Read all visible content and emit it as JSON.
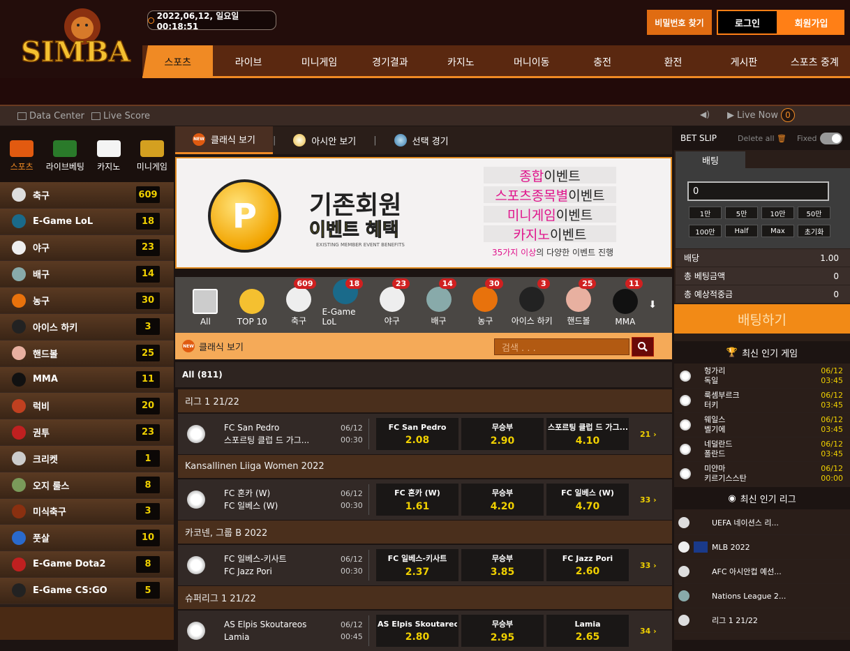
{
  "header": {
    "logo_text": "SIMBA",
    "datetime": "2022,06,12, 일요일 00:18:51",
    "find_password": "비밀번호 찾기",
    "login": "로그인",
    "join": "회원가입"
  },
  "nav": [
    "스포츠",
    "라이브",
    "미니게임",
    "경기결과",
    "카지노",
    "머니이동",
    "충전",
    "환전",
    "게시판",
    "스포츠 중계"
  ],
  "databar": {
    "data_center": "Data Center",
    "live_score": "Live Score",
    "live_now": "Live Now",
    "live_count": "0"
  },
  "left_tabs": [
    "스포츠",
    "라이브베팅",
    "카지노",
    "미니게임"
  ],
  "sports": [
    {
      "name": "축구",
      "count": "609"
    },
    {
      "name": "E-Game LoL",
      "count": "18"
    },
    {
      "name": "야구",
      "count": "23"
    },
    {
      "name": "배구",
      "count": "14"
    },
    {
      "name": "농구",
      "count": "30"
    },
    {
      "name": "아이스 하키",
      "count": "3"
    },
    {
      "name": "핸드볼",
      "count": "25"
    },
    {
      "name": "MMA",
      "count": "11"
    },
    {
      "name": "럭비",
      "count": "20"
    },
    {
      "name": "권투",
      "count": "23"
    },
    {
      "name": "크리켓",
      "count": "1"
    },
    {
      "name": "오지 룰스",
      "count": "8"
    },
    {
      "name": "미식축구",
      "count": "3"
    },
    {
      "name": "풋살",
      "count": "10"
    },
    {
      "name": "E-Game Dota2",
      "count": "8"
    },
    {
      "name": "E-Game CS:GO",
      "count": "5"
    }
  ],
  "center_tabs": {
    "classic": "클래식 보기",
    "asian": "아시안 보기",
    "select": "선택 경기",
    "sep": "|"
  },
  "banner": {
    "title": "기존회원",
    "subtitle": "이벤트 혜택",
    "small": "EXISTING MEMBER EVENT BENEFITS",
    "coin": "P",
    "events": [
      {
        "hl": "종합",
        "rest": "이벤트"
      },
      {
        "hl": "스포츠종목별",
        "rest": "이벤트"
      },
      {
        "hl": "미니게임",
        "rest": "이벤트"
      },
      {
        "hl": "카지노",
        "rest": "이벤트"
      }
    ],
    "note_hl": "35가지 이상",
    "note_rest": "의 다양한 이벤트 진행"
  },
  "categories": [
    {
      "name": "All",
      "count": ""
    },
    {
      "name": "TOP 10",
      "count": ""
    },
    {
      "name": "축구",
      "count": "609"
    },
    {
      "name": "E-Game LoL",
      "count": "18"
    },
    {
      "name": "야구",
      "count": "23"
    },
    {
      "name": "배구",
      "count": "14"
    },
    {
      "name": "농구",
      "count": "30"
    },
    {
      "name": "아이스 하키",
      "count": "3"
    },
    {
      "name": "핸드볼",
      "count": "25"
    },
    {
      "name": "MMA",
      "count": "11"
    }
  ],
  "search": {
    "label": "클래식 보기",
    "placeholder": "검색 . . ."
  },
  "all_label": "All (811)",
  "leagues": [
    {
      "name": "리그 1 21/22",
      "home": "FC San Pedro",
      "away": "스포르팅 클럽 드 가그...",
      "date": "06/12",
      "time": "00:30",
      "o1n": "FC San Pedro",
      "o1": "2.08",
      "oxn": "무승부",
      "ox": "2.90",
      "o2n": "스포르팅 클럽 드 가그...",
      "o2": "4.10",
      "more": "21"
    },
    {
      "name": "Kansallinen Liiga Women 2022",
      "home": "FC 혼카 (W)",
      "away": "FC 일베스 (W)",
      "date": "06/12",
      "time": "00:30",
      "o1n": "FC 혼카 (W)",
      "o1": "1.61",
      "oxn": "무승부",
      "ox": "4.20",
      "o2n": "FC 일베스 (W)",
      "o2": "4.70",
      "more": "33"
    },
    {
      "name": "카코넨, 그룹 B 2022",
      "home": "FC 일베스-키사트",
      "away": "FC Jazz Pori",
      "date": "06/12",
      "time": "00:30",
      "o1n": "FC 일베스-키사트",
      "o1": "2.37",
      "oxn": "무승부",
      "ox": "3.85",
      "o2n": "FC Jazz Pori",
      "o2": "2.60",
      "more": "33"
    },
    {
      "name": "슈퍼리그 1 21/22",
      "home": "AS Elpis Skoutareos",
      "away": "Lamia",
      "date": "06/12",
      "time": "00:45",
      "o1n": "AS Elpis Skoutareos",
      "o1": "2.80",
      "oxn": "무승부",
      "ox": "2.95",
      "o2n": "Lamia",
      "o2": "2.65",
      "more": "34"
    }
  ],
  "betslip": {
    "title": "BET SLIP",
    "delete_all": "Delete all",
    "fixed": "Fixed",
    "tab": "배팅",
    "amount": "0",
    "buttons": [
      "1만",
      "5만",
      "10만",
      "50만",
      "100만",
      "Half",
      "Max",
      "초기화"
    ],
    "rows": [
      {
        "label": "배당",
        "value": "1.00"
      },
      {
        "label": "총 베팅금액",
        "value": "0"
      },
      {
        "label": "총 예상적중금",
        "value": "0"
      }
    ],
    "submit": "배팅하기"
  },
  "popular_games": {
    "title": "최신 인기 게임",
    "items": [
      {
        "home": "헝가리",
        "away": "독일",
        "date": "06/12",
        "time": "03:45"
      },
      {
        "home": "룩셈부르크",
        "away": "터키",
        "date": "06/12",
        "time": "03:45"
      },
      {
        "home": "웨일스",
        "away": "벨기에",
        "date": "06/12",
        "time": "03:45"
      },
      {
        "home": "네덜란드",
        "away": "폴란드",
        "date": "06/12",
        "time": "03:45"
      },
      {
        "home": "미얀마",
        "away": "키르기스스탄",
        "date": "06/12",
        "time": "00:00"
      }
    ]
  },
  "popular_leagues": {
    "title": "최신 인기 리그",
    "items": [
      "UEFA 네이션스 리...",
      "MLB 2022",
      "AFC 아시안컵 예선...",
      "Nations League 2...",
      "리그 1 21/22"
    ]
  }
}
